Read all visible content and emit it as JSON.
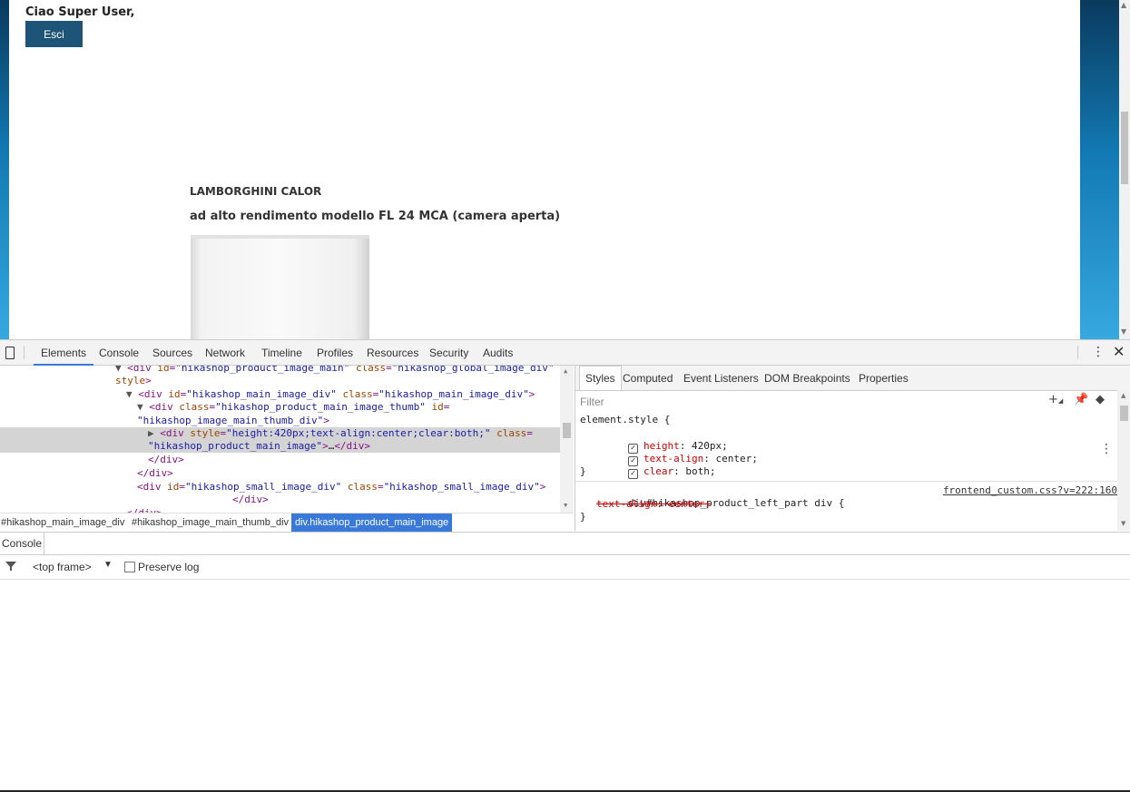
{
  "page": {
    "greeting": "Ciao Super User,",
    "logout_label": "Esci",
    "product_title": "LAMBORGHINI CALOR",
    "product_subtitle": "ad alto rendimento modello FL 24 MCA (camera aperta)"
  },
  "devtools": {
    "tabs": [
      "Elements",
      "Console",
      "Sources",
      "Network",
      "Timeline",
      "Profiles",
      "Resources",
      "Security",
      "Audits"
    ],
    "active_tab": "Elements",
    "dom_lines": [
      {
        "parts": [
          [
            "tri",
            "▼"
          ],
          [
            "tg",
            "<div "
          ],
          [
            "at",
            "id"
          ],
          [
            "tg",
            "="
          ],
          [
            "av",
            "\"hikashop_product_image_main\""
          ],
          [
            "tg",
            " "
          ],
          [
            "at",
            "class"
          ],
          [
            "tg",
            "="
          ],
          [
            "av",
            "\"hikashop_global_image_div\""
          ]
        ]
      },
      {
        "parts": [
          [
            "at",
            "style"
          ],
          [
            "tg",
            ">"
          ]
        ]
      },
      {
        "parts": [
          [
            "tri",
            "▼"
          ],
          [
            "tg",
            "<div "
          ],
          [
            "at",
            "id"
          ],
          [
            "tg",
            "="
          ],
          [
            "av",
            "\"hikashop_main_image_div\""
          ],
          [
            "tg",
            " "
          ],
          [
            "at",
            "class"
          ],
          [
            "tg",
            "="
          ],
          [
            "av",
            "\"hikashop_main_image_div\""
          ],
          [
            "tg",
            ">"
          ]
        ]
      },
      {
        "parts": [
          [
            "tri",
            "▼"
          ],
          [
            "tg",
            "<div "
          ],
          [
            "at",
            "class"
          ],
          [
            "tg",
            "="
          ],
          [
            "av",
            "\"hikashop_product_main_image_thumb\""
          ],
          [
            "tg",
            " "
          ],
          [
            "at",
            "id"
          ],
          [
            "tg",
            "="
          ]
        ]
      },
      {
        "parts": [
          [
            "av",
            "\"hikashop_image_main_thumb_div\""
          ],
          [
            "tg",
            ">"
          ]
        ]
      },
      {
        "parts": [
          [
            "tri",
            "▶"
          ],
          [
            "tg",
            "<div "
          ],
          [
            "at",
            "style"
          ],
          [
            "tg",
            "="
          ],
          [
            "av",
            "\"height:420px;text-align:center;clear:both;\""
          ],
          [
            "tg",
            " "
          ],
          [
            "at",
            "class"
          ],
          [
            "tg",
            "="
          ]
        ]
      },
      {
        "parts": [
          [
            "av",
            "\"hikashop_product_main_image\""
          ],
          [
            "tg",
            ">"
          ],
          [
            "tx",
            "…"
          ],
          [
            "tg",
            "</div>"
          ]
        ]
      },
      {
        "parts": [
          [
            "tg",
            "</div>"
          ]
        ]
      },
      {
        "parts": [
          [
            "tg",
            "</div>"
          ]
        ]
      },
      {
        "parts": [
          [
            "tg",
            "<div "
          ],
          [
            "at",
            "id"
          ],
          [
            "tg",
            "="
          ],
          [
            "av",
            "\"hikashop_small_image_div\""
          ],
          [
            "tg",
            " "
          ],
          [
            "at",
            "class"
          ],
          [
            "tg",
            "="
          ],
          [
            "av",
            "\"hikashop_small_image_div\""
          ],
          [
            "tg",
            ">"
          ]
        ]
      },
      {
        "parts": [
          [
            "tg",
            "</div>"
          ]
        ]
      },
      {
        "parts": [
          [
            "tg",
            "</div>"
          ]
        ]
      }
    ],
    "breadcrumbs": [
      "#hikashop_main_image_div",
      "#hikashop_image_main_thumb_div",
      "div.hikashop_product_main_image"
    ],
    "styles_tabs": [
      "Styles",
      "Computed",
      "Event Listeners",
      "DOM Breakpoints",
      "Properties"
    ],
    "filter_placeholder": "Filter",
    "element_style_selector": "element.style {",
    "element_style_props": [
      {
        "name": "height",
        "value": "420px;"
      },
      {
        "name": "text-align",
        "value": "center;"
      },
      {
        "name": "clear",
        "value": "both;"
      }
    ],
    "close_brace": "}",
    "rule2_selector": "div#hikashop_product_left_part div {",
    "rule2_source": "frontend_custom.css?v=222:160",
    "rule2_prop": "text-align: center;",
    "drawer_tab": "Console",
    "frame_selector": "<top frame>",
    "preserve_log": "Preserve log"
  }
}
